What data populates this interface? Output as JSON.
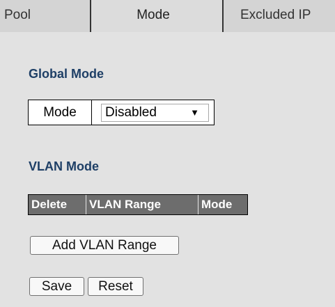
{
  "tabs": [
    {
      "label": "Pool"
    },
    {
      "label": "Mode"
    },
    {
      "label": "Excluded IP"
    }
  ],
  "global_mode": {
    "title": "Global Mode",
    "field_label": "Mode",
    "selected_value": "Disabled"
  },
  "vlan_mode": {
    "title": "VLAN Mode",
    "columns": [
      "Delete",
      "VLAN Range",
      "Mode"
    ]
  },
  "buttons": {
    "add_vlan_range": "Add VLAN Range",
    "save": "Save",
    "reset": "Reset"
  },
  "icons": {
    "select_arrow": "triangle-down-icon"
  },
  "colors": {
    "background": "#e2e2e2",
    "section_title": "#1e3f66",
    "vlan_header": "#6d6d6d"
  }
}
